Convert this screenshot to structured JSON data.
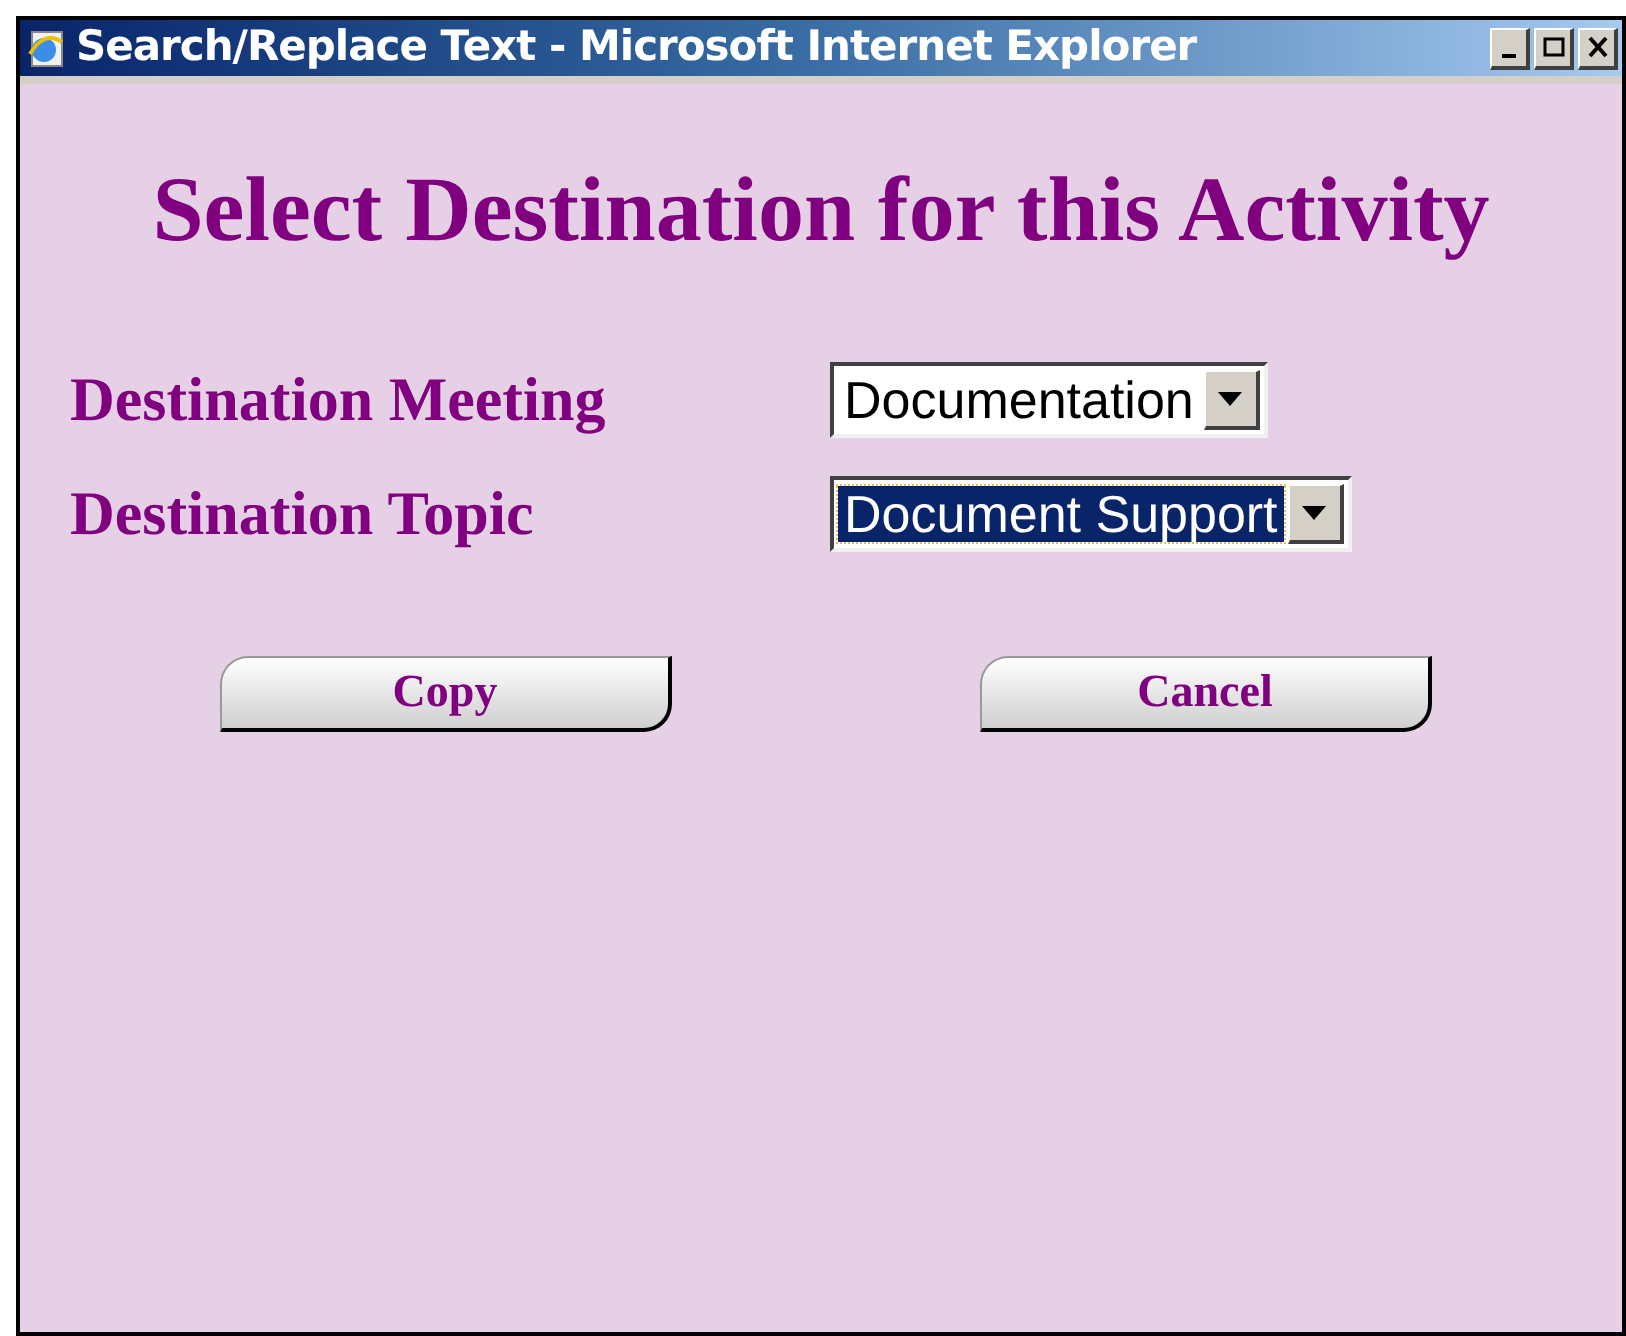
{
  "window": {
    "title": "Search/Replace Text - Microsoft Internet Explorer"
  },
  "heading": "Select Destination for this Activity",
  "fields": [
    {
      "label": "Destination Meeting",
      "value": "Documentation",
      "focused": false
    },
    {
      "label": "Destination Topic",
      "value": "Document Support",
      "focused": true
    }
  ],
  "buttons": [
    "Copy",
    "Cancel"
  ]
}
